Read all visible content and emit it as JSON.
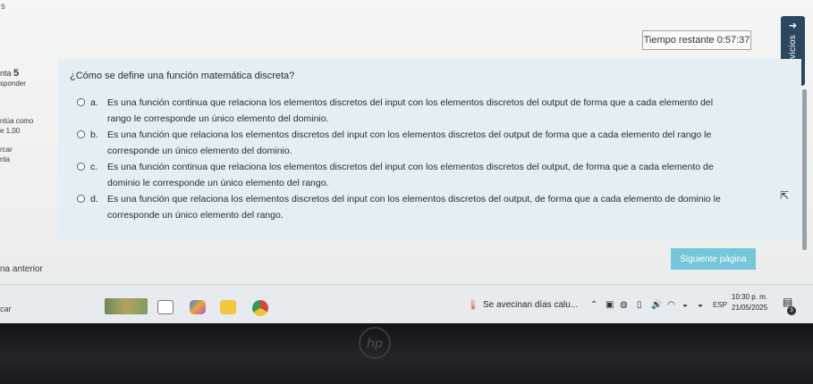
{
  "corner_char": "s",
  "timer": {
    "text": "Tiempo restante 0:57:37"
  },
  "services": {
    "label": "Servicios",
    "arrow": "➜",
    "icon": "≡"
  },
  "info": {
    "question_label": "nta",
    "question_number": "5",
    "status": "sponder",
    "score_label": "ntúa como",
    "score_value": "e 1,00",
    "flag": "rcar",
    "flag2": "nta"
  },
  "question": {
    "text": "¿Cómo se define una función matemática discreta?",
    "options": [
      {
        "letter": "a.",
        "text": "Es una función continua que relaciona los elementos discretos del input con los elementos discretos del output de forma que a cada elemento del rango le corresponde un único elemento del dominio."
      },
      {
        "letter": "b.",
        "text": "Es una función que relaciona los elementos discretos del input con los elementos discretos del output de forma que a cada elemento del rango le corresponde un único elemento del dominio."
      },
      {
        "letter": "c.",
        "text": "Es una función continua que relaciona los elementos discretos del input con los elementos discretos del output, de forma que a cada elemento de dominio le corresponde un único elemento del rango."
      },
      {
        "letter": "d.",
        "text": "Es una función que relaciona los elementos discretos del input con los elementos discretos del output, de forma que a cada elemento de dominio le corresponde un único elemento del rango."
      }
    ]
  },
  "nav": {
    "prev_label": "na anterior",
    "next_label": "Siguiente página"
  },
  "taskbar": {
    "search_text": "car",
    "weather_text": "Se avecinan días calu...",
    "lang": "ESP",
    "time": "10:30 p. m.",
    "date": "21/05/2025",
    "notif_count": "3"
  },
  "brand": {
    "logo": "hp"
  },
  "colors": {
    "question_bg": "#e3eff3",
    "next_button": "#76c6d9",
    "services_tab": "#2b4760"
  }
}
